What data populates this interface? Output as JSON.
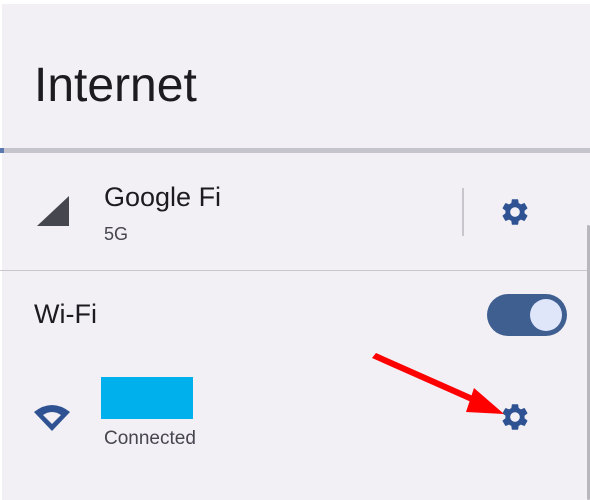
{
  "page": {
    "title": "Internet"
  },
  "carrier": {
    "name": "Google Fi",
    "network_type": "5G",
    "icon": "signal-cellular-icon",
    "settings_icon": "gear-icon"
  },
  "wifi": {
    "label": "Wi-Fi",
    "enabled": true,
    "toggle_icon": "toggle-switch-on"
  },
  "network": {
    "name_redacted": true,
    "status": "Connected",
    "icon": "wifi-icon",
    "settings_icon": "gear-icon"
  },
  "annotation": {
    "type": "arrow",
    "color": "#ff0000"
  },
  "colors": {
    "background": "#f2eff5",
    "accent": "#3f5f91",
    "redaction": "#00b0ec",
    "divider": "#c8c6cc"
  }
}
